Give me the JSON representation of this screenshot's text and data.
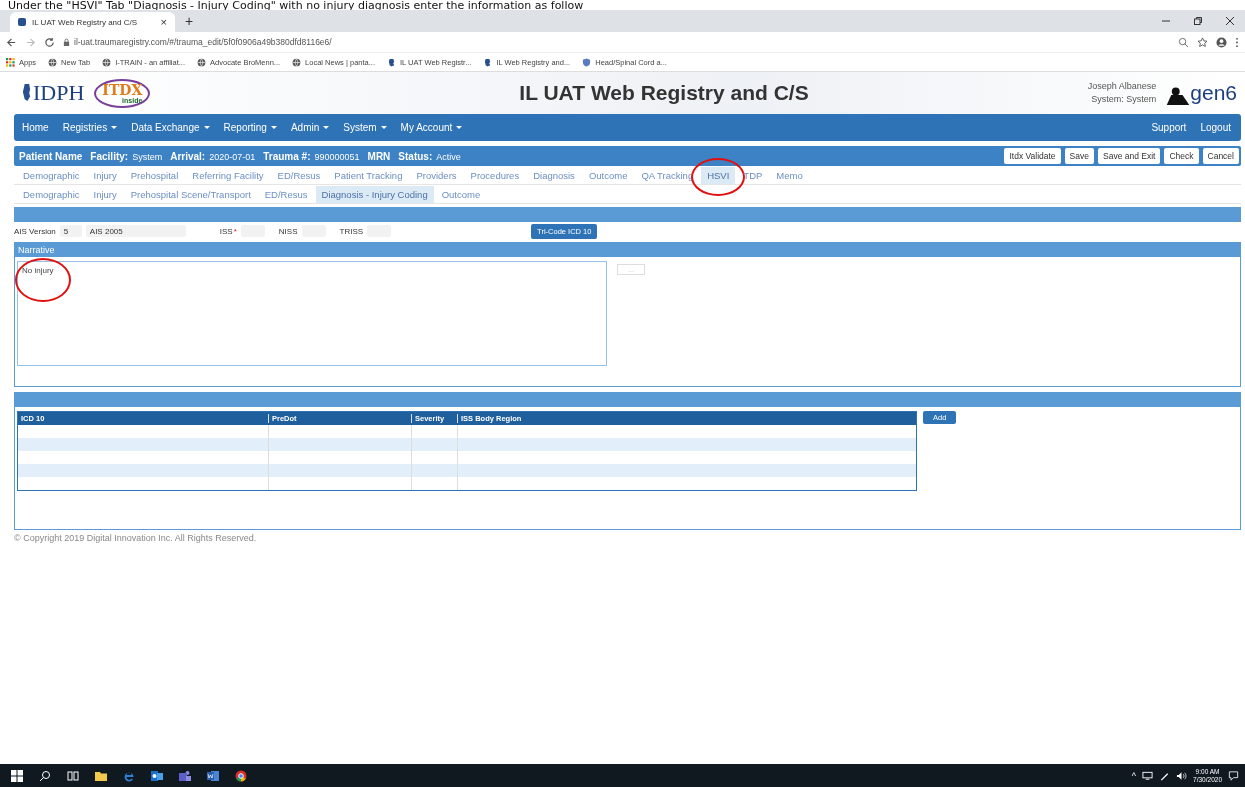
{
  "caption": "Under the \"HSVI\" Tab \"Diagnosis - Injury Coding\" with no injury diagnosis enter the information as follow",
  "browser": {
    "tab_title": "IL UAT Web Registry and C/S",
    "tab_close": "×",
    "new_tab": "+",
    "url": "il-uat.traumaregistry.com/#/trauma_edit/5f0f0906a49b380dfd8116e6/",
    "bookmarks": [
      {
        "label": "Apps",
        "kind": "apps"
      },
      {
        "label": "New Tab",
        "kind": "globe"
      },
      {
        "label": "I-TRAIN - an affiliat...",
        "kind": "globe"
      },
      {
        "label": "Advocate BroMenn...",
        "kind": "globe"
      },
      {
        "label": "Local News | panta...",
        "kind": "globe"
      },
      {
        "label": "IL UAT Web Registr...",
        "kind": "site"
      },
      {
        "label": "IL Web Registry and...",
        "kind": "site"
      },
      {
        "label": "Head/Spinal Cord a...",
        "kind": "shield"
      }
    ]
  },
  "header": {
    "logo_1": "IDPH",
    "logo_2": "ITDX",
    "logo_2_sub": "inside",
    "title": "IL UAT Web Registry and C/S",
    "user_name": "Joseph Albanese",
    "user_role": "System: System",
    "logo_3": "gen6"
  },
  "nav": [
    {
      "label": "Home",
      "dropdown": false
    },
    {
      "label": "Registries",
      "dropdown": true
    },
    {
      "label": "Data Exchange",
      "dropdown": true
    },
    {
      "label": "Reporting",
      "dropdown": true
    },
    {
      "label": "Admin",
      "dropdown": true
    },
    {
      "label": "System",
      "dropdown": true
    },
    {
      "label": "My Account",
      "dropdown": true
    }
  ],
  "nav_right": [
    "Support",
    "Logout"
  ],
  "patient_bar": [
    {
      "label": "Patient Name"
    },
    {
      "label": "Facility:",
      "value": "System"
    },
    {
      "label": "Arrival:",
      "value": "2020-07-01"
    },
    {
      "label": "Trauma #:",
      "value": "990000051"
    },
    {
      "label": "MRN"
    },
    {
      "label": "Status:",
      "value": "Active"
    }
  ],
  "actions": [
    "Itdx Validate",
    "Save",
    "Save and Exit",
    "Check",
    "Cancel"
  ],
  "tabs": [
    {
      "label": "Demographic",
      "selected": false,
      "circled": false
    },
    {
      "label": "Injury",
      "selected": false,
      "circled": false
    },
    {
      "label": "Prehospital",
      "selected": false,
      "circled": false
    },
    {
      "label": "Referring Facility",
      "selected": false,
      "circled": false
    },
    {
      "label": "ED/Resus",
      "selected": false,
      "circled": false
    },
    {
      "label": "Patient Tracking",
      "selected": false,
      "circled": false
    },
    {
      "label": "Providers",
      "selected": false,
      "circled": false
    },
    {
      "label": "Procedures",
      "selected": false,
      "circled": false
    },
    {
      "label": "Diagnosis",
      "selected": false,
      "circled": false
    },
    {
      "label": "Outcome",
      "selected": false,
      "circled": false
    },
    {
      "label": "QA Tracking",
      "selected": false,
      "circled": false
    },
    {
      "label": "HSVI",
      "selected": true,
      "circled": true
    },
    {
      "label": "TDP",
      "selected": false,
      "circled": false
    },
    {
      "label": "Memo",
      "selected": false,
      "circled": false
    }
  ],
  "subtabs": [
    {
      "label": "Demographic",
      "selected": false
    },
    {
      "label": "Injury",
      "selected": false
    },
    {
      "label": "Prehospital Scene/Transport",
      "selected": false
    },
    {
      "label": "ED/Resus",
      "selected": false
    },
    {
      "label": "Diagnosis - Injury Coding",
      "selected": true
    },
    {
      "label": "Outcome",
      "selected": false
    }
  ],
  "scores": {
    "ais_label": "AIS Version",
    "ais_version": "5",
    "ais_name": "AIS 2005",
    "iss_label": "ISS",
    "iss_required_mark": "*",
    "niss_label": "NISS",
    "triss_label": "TRISS",
    "tricode_button": "Tri-Code ICD 10"
  },
  "narrative": {
    "title": "Narrative",
    "value": "No injury",
    "circled": true,
    "side_button": "..."
  },
  "table": {
    "columns": [
      "ICD 10",
      "PreDot",
      "Severity",
      "ISS Body Region"
    ],
    "add_button": "Add"
  },
  "copyright": "© Copyright 2019 Digital Innovation Inc. All Rights Reserved.",
  "taskbar": {
    "apps": [
      {
        "kind": "windows"
      },
      {
        "kind": "search"
      },
      {
        "kind": "taskview"
      },
      {
        "kind": "folder"
      },
      {
        "kind": "edge"
      },
      {
        "kind": "outlook"
      },
      {
        "kind": "teams"
      },
      {
        "kind": "word"
      },
      {
        "kind": "chrome"
      }
    ],
    "tray_arrow": "^",
    "time": "9:00 AM",
    "date": "7/30/2020"
  }
}
